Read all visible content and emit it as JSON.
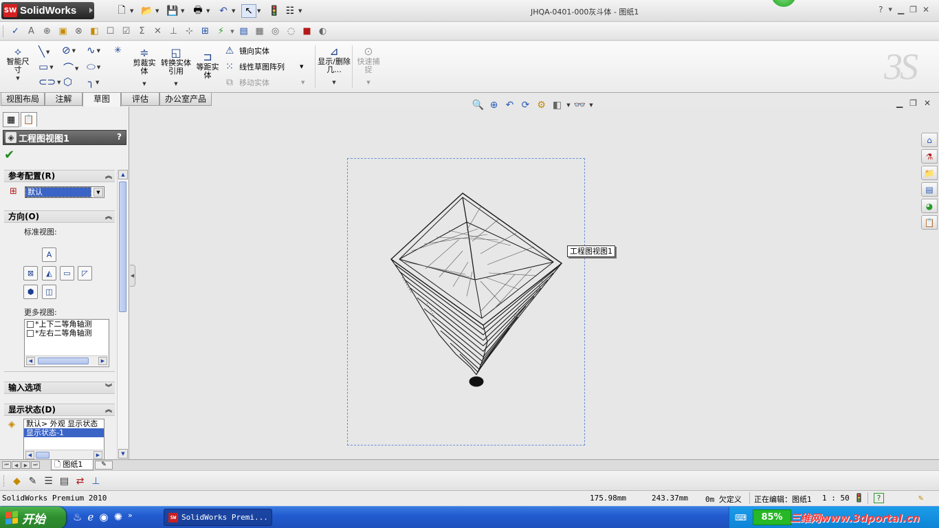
{
  "app": {
    "logo_text": "SolidWorks",
    "document_title": "JHQA-0401-000灰斗体 - 图纸1"
  },
  "command_manager": {
    "smart_dimension": "智能尺寸",
    "trim_entities": "剪裁实体",
    "convert_entities": "转换实体引用",
    "offset_entities": "等距实体",
    "mirror_entities": "镜向实体",
    "linear_pattern": "线性草图阵列",
    "move_entities": "移动实体",
    "display_delete_relations": "显示/删除几...",
    "quick_snaps": "快速捕捉"
  },
  "tabs": [
    {
      "label": "视图布局"
    },
    {
      "label": "注解"
    },
    {
      "label": "草图"
    },
    {
      "label": "评估"
    },
    {
      "label": "办公室产品"
    }
  ],
  "property_manager": {
    "title": "工程图视图1",
    "help": "?",
    "reference_config": {
      "header": "参考配置(R)",
      "value": "默认"
    },
    "orientation": {
      "header": "方向(O)",
      "standard_views_label": "标准视图:",
      "more_views_label": "更多视图:",
      "more_views": [
        "*上下二等角轴测",
        "*左右二等角轴测"
      ]
    },
    "import_options": {
      "header": "输入选项"
    },
    "display_state": {
      "header": "显示状态(D)",
      "items": [
        "默认> 外观 显示状态",
        "显示状态-1"
      ]
    }
  },
  "sheet_tabs": [
    {
      "label": "图纸1"
    }
  ],
  "graphics": {
    "view_label": "工程图视图1"
  },
  "status_bar": {
    "product": "SolidWorks Premium 2010",
    "x": "175.98mm",
    "y": "243.37mm",
    "z_state": "0m 欠定义",
    "editing": "正在编辑：图纸1",
    "scale": "1 : 50",
    "help": "?"
  },
  "taskbar": {
    "start_label": "开始",
    "task_label": "SolidWorks Premi...",
    "battery_percent": "85%",
    "watermark": "三维网www.3dportal.cn"
  },
  "colors": {
    "view_border": "#6b8fd8",
    "taskbar_blue": "#225cd0",
    "start_green": "#2f902f",
    "selection_blue": "#3a64c6"
  }
}
